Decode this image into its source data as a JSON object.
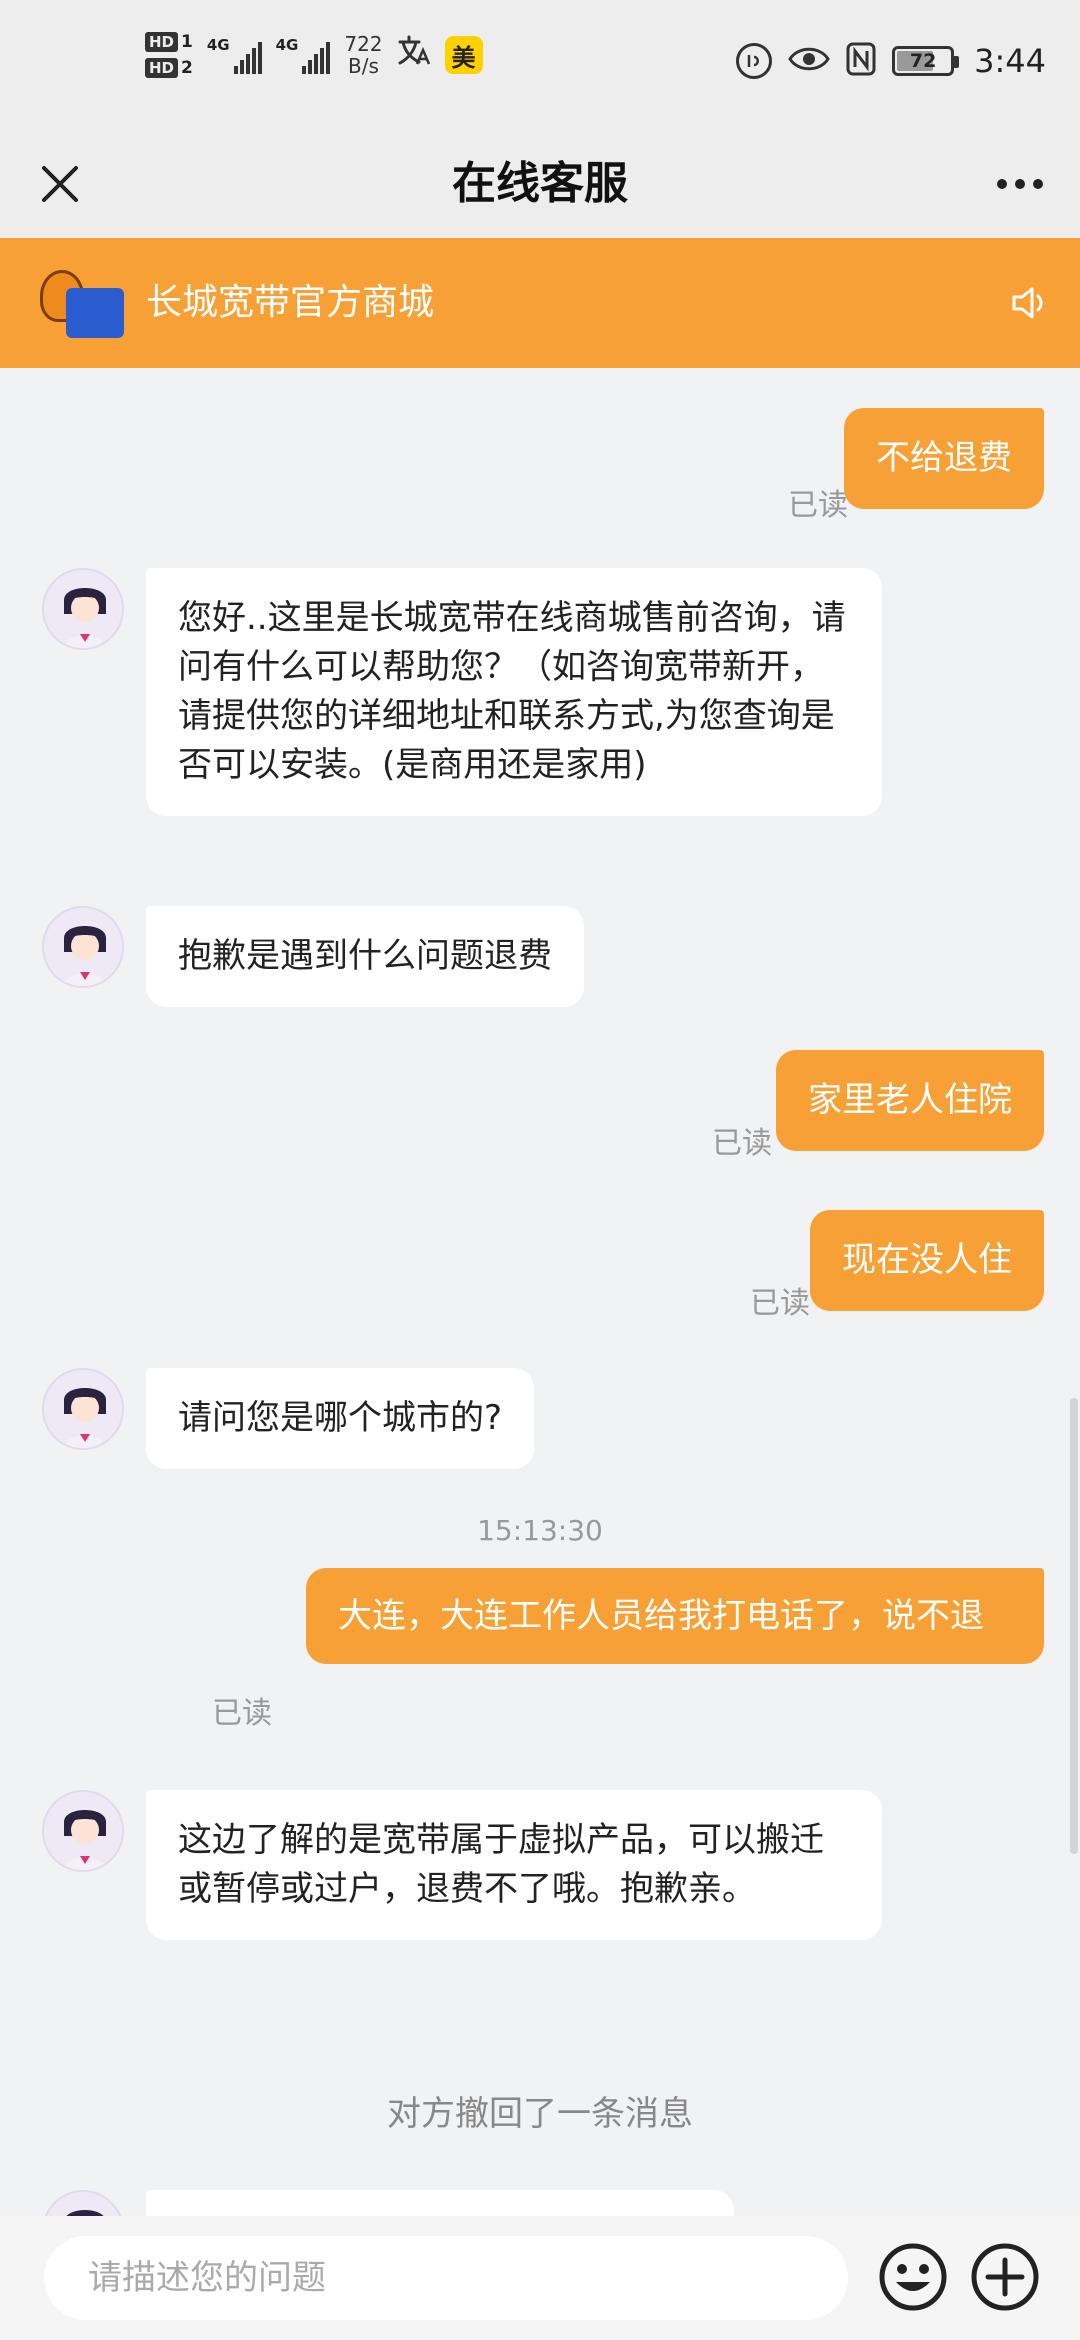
{
  "status_bar": {
    "hd1": "HD",
    "sim1": "1",
    "hd2": "HD",
    "sim2": "2",
    "net1": "4G",
    "net2": "4G",
    "speed_value": "722",
    "speed_unit": "B/s",
    "app_badge": "美",
    "nfc": "N",
    "battery": "72",
    "battery_level": 0.72,
    "time": "3:44"
  },
  "header": {
    "title": "在线客服"
  },
  "shop": {
    "name": "长城宽带官方商城"
  },
  "chat": {
    "read_label": "已读",
    "messages": [
      {
        "from": "user",
        "text": "不给退费"
      },
      {
        "from": "agent",
        "text": "您好..这里是长城宽带在线商城售前咨询，请问有什么可以帮助您？（如咨询宽带新开，请提供您的详细地址和联系方式,为您查询是否可以安装。(是商用还是家用)"
      },
      {
        "from": "agent",
        "text": "抱歉是遇到什么问题退费"
      },
      {
        "from": "user",
        "text": "家里老人住院"
      },
      {
        "from": "user",
        "text": "现在没人住"
      },
      {
        "from": "agent",
        "text": "请问您是哪个城市的?"
      },
      {
        "from": "user",
        "text": "大连，大连工作人员给我打电话了，说不退"
      },
      {
        "from": "agent",
        "text": "这边了解的是宽带属于虚拟产品，可以搬迁或暂停或过户，退费不了哦。抱歉亲。"
      }
    ],
    "timestamp": "15:13:30",
    "system_notice": "对方撤回了一条消息"
  },
  "input": {
    "placeholder": "请描述您的问题"
  },
  "colors": {
    "accent": "#f7a036",
    "background": "#f1f2f4"
  }
}
